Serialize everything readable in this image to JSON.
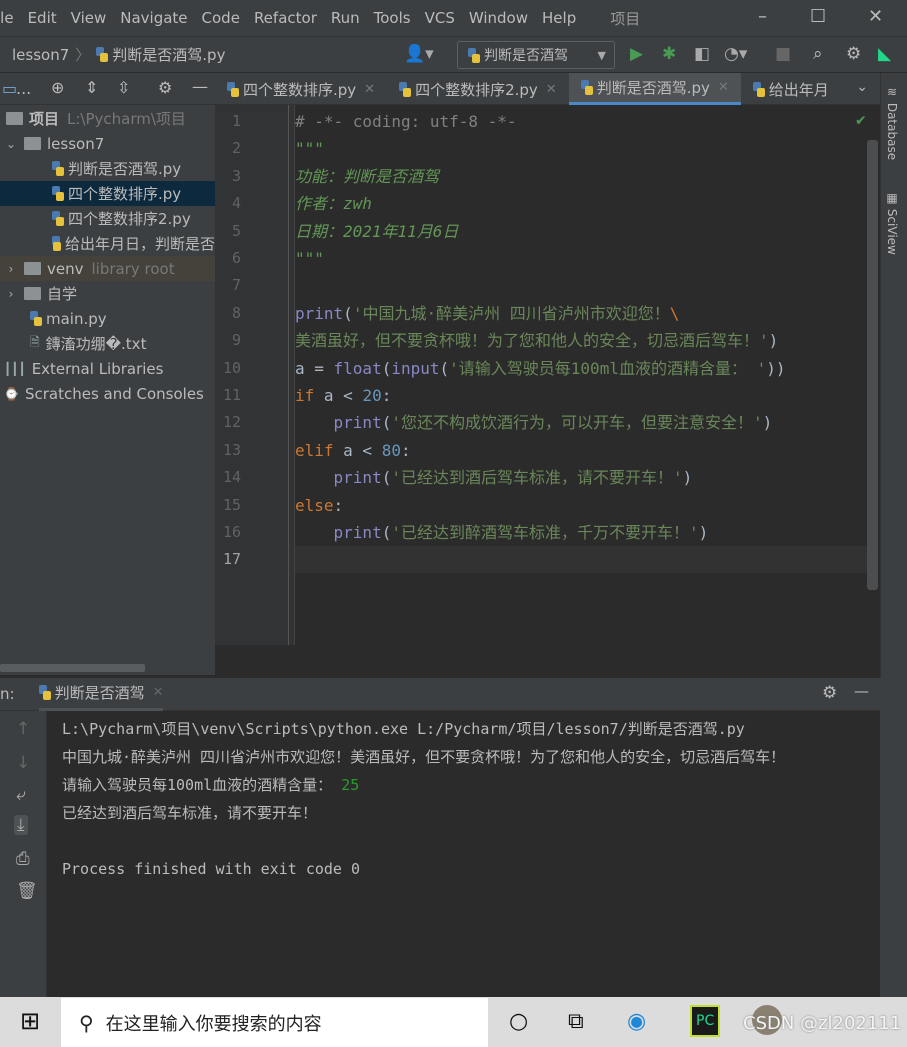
{
  "menu": {
    "items": [
      "ile",
      "Edit",
      "View",
      "Navigate",
      "Code",
      "Refactor",
      "Run",
      "Tools",
      "VCS",
      "Window",
      "Help"
    ],
    "project_title": "项目"
  },
  "window_controls": {
    "minimize": "–",
    "maximize": "☐",
    "close": "✕"
  },
  "navbar": {
    "breadcrumb": [
      "lesson7",
      "判断是否酒驾.py"
    ],
    "run_config": "判断是否酒驾"
  },
  "editor_tabs": [
    {
      "label": "四个整数排序.py",
      "active": false
    },
    {
      "label": "四个整数排序2.py",
      "active": false
    },
    {
      "label": "判断是否酒驾.py",
      "active": true
    },
    {
      "label": "给出年月",
      "active": false
    }
  ],
  "project_tree": {
    "tool_label": "...",
    "root": {
      "label": "项目",
      "path": "L:\\Pycharm\\项目"
    },
    "items": [
      {
        "label": "lesson7",
        "type": "folder",
        "expanded": true,
        "depth": 1
      },
      {
        "label": "判断是否酒驾.py",
        "type": "py",
        "depth": 2
      },
      {
        "label": "四个整数排序.py",
        "type": "py",
        "depth": 2,
        "selected": true
      },
      {
        "label": "四个整数排序2.py",
        "type": "py",
        "depth": 2
      },
      {
        "label": "给出年月日，判断是否",
        "type": "py",
        "depth": 2
      },
      {
        "label": "venv",
        "hint": "library root",
        "type": "folder",
        "expanded": false,
        "depth": 1
      },
      {
        "label": "自学",
        "type": "folder",
        "expanded": false,
        "depth": 1
      },
      {
        "label": "main.py",
        "type": "py",
        "depth": 1
      },
      {
        "label": "鏄滀功绷�.txt",
        "type": "txt",
        "depth": 1
      },
      {
        "label": "External Libraries",
        "type": "lib",
        "depth": 0
      },
      {
        "label": "Scratches and Consoles",
        "type": "scratch",
        "depth": 0
      }
    ]
  },
  "code": {
    "current_line": 17,
    "lines": [
      [
        [
          "# -*- coding: utf-8 -*-",
          "cm"
        ]
      ],
      [
        [
          "\"\"\"",
          "doc"
        ]
      ],
      [
        [
          "功能：判断是否酒驾",
          "doc"
        ]
      ],
      [
        [
          "作者：zwh",
          "doc"
        ]
      ],
      [
        [
          "日期：2021年11月6日",
          "doc"
        ]
      ],
      [
        [
          "\"\"\"",
          "doc"
        ]
      ],
      [],
      [
        [
          "print",
          "bi"
        ],
        [
          "(",
          "tx"
        ],
        [
          "'中国九城·醉美泸州 四川省泸州市欢迎您！",
          "str"
        ],
        [
          "\\",
          "kw"
        ]
      ],
      [
        [
          "美酒虽好，但不要贪杯哦！为了您和他人的安全，切忌酒后驾车！'",
          "str"
        ],
        [
          ")",
          "tx"
        ]
      ],
      [
        [
          "a = ",
          "tx"
        ],
        [
          "float",
          "bi"
        ],
        [
          "(",
          "tx"
        ],
        [
          "input",
          "bi"
        ],
        [
          "(",
          "tx"
        ],
        [
          "'请输入驾驶员每100ml血液的酒精含量： '",
          "str"
        ],
        [
          "))",
          "tx"
        ]
      ],
      [
        [
          "if",
          "kw"
        ],
        [
          " a < ",
          "tx"
        ],
        [
          "20",
          "num"
        ],
        [
          ":",
          "tx"
        ]
      ],
      [
        [
          "    ",
          "tx"
        ],
        [
          "print",
          "bi"
        ],
        [
          "(",
          "tx"
        ],
        [
          "'您还不构成饮酒行为，可以开车，但要注意安全！'",
          "str"
        ],
        [
          ")",
          "tx"
        ]
      ],
      [
        [
          "elif",
          "kw"
        ],
        [
          " a < ",
          "tx"
        ],
        [
          "80",
          "num"
        ],
        [
          ":",
          "tx"
        ]
      ],
      [
        [
          "    ",
          "tx"
        ],
        [
          "print",
          "bi"
        ],
        [
          "(",
          "tx"
        ],
        [
          "'已经达到酒后驾车标准，请不要开车！'",
          "str"
        ],
        [
          ")",
          "tx"
        ]
      ],
      [
        [
          "else",
          "kw"
        ],
        [
          ":",
          "tx"
        ]
      ],
      [
        [
          "    ",
          "tx"
        ],
        [
          "print",
          "bi"
        ],
        [
          "(",
          "tx"
        ],
        [
          "'已经达到醉酒驾车标准，千万不要开车！'",
          "str"
        ],
        [
          ")",
          "tx"
        ]
      ],
      []
    ]
  },
  "right_tools": [
    "Database",
    "SciView"
  ],
  "run": {
    "label": "n:",
    "tab": "判断是否酒驾",
    "output": [
      "L:\\Pycharm\\项目\\venv\\Scripts\\python.exe L:/Pycharm/项目/lesson7/判断是否酒驾.py",
      "中国九城·醉美泸州 四川省泸州市欢迎您！美酒虽好，但不要贪杯哦！为了您和他人的安全，切忌酒后驾车！",
      "请输入驾驶员每100ml血液的酒精含量： ",
      "已经达到酒后驾车标准，请不要开车！",
      "",
      "Process finished with exit code 0"
    ],
    "user_input": "25"
  },
  "taskbar": {
    "search_placeholder": "在这里输入你要搜索的内容",
    "watermark": "CSDN @zl202111"
  },
  "colors": {
    "keyword": "#cc7832",
    "string": "#6a8759",
    "docstring": "#629755",
    "builtin": "#8888c6",
    "number": "#6897bb",
    "comment": "#808080",
    "selection": "#0d293e",
    "run_green": "#499c54",
    "tab_underline": "#4a88c7"
  }
}
